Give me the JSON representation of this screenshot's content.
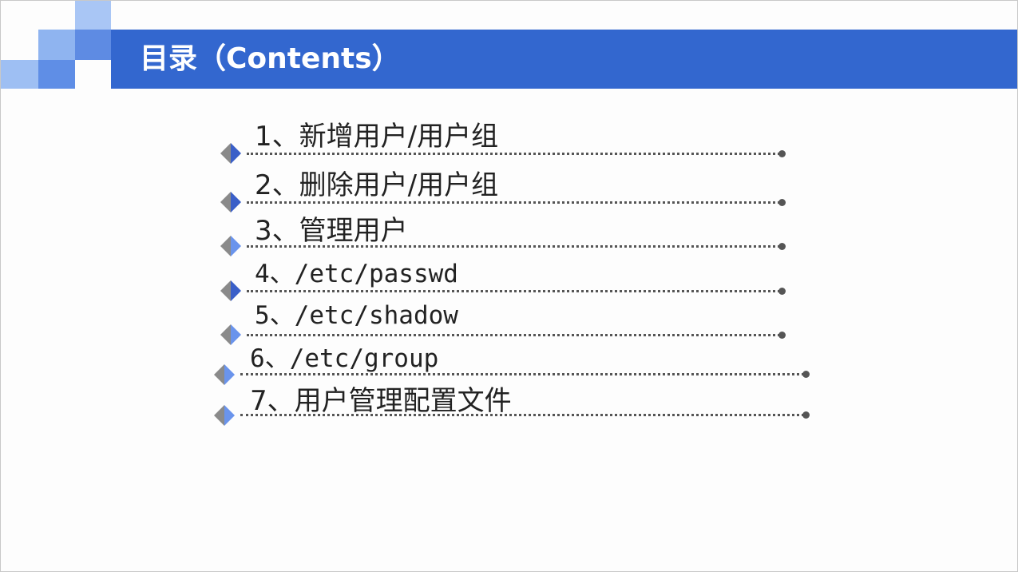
{
  "header": {
    "title": "目录（Contents）"
  },
  "toc": {
    "items": [
      {
        "label": "1、新增用户/用户组"
      },
      {
        "label": "2、删除用户/用户组"
      },
      {
        "label": "3、管理用户"
      },
      {
        "label": "4、/etc/passwd"
      },
      {
        "label": "5、/etc/shadow"
      },
      {
        "label": "6、/etc/group"
      },
      {
        "label": "7、用户管理配置文件"
      }
    ]
  },
  "colors": {
    "title_bar": "#3367cf",
    "accent_light": "#a9c6f5",
    "accent_mid": "#5e8be3",
    "marker_dark": "#3a5fc8",
    "marker_gray": "#8a8a8a"
  }
}
